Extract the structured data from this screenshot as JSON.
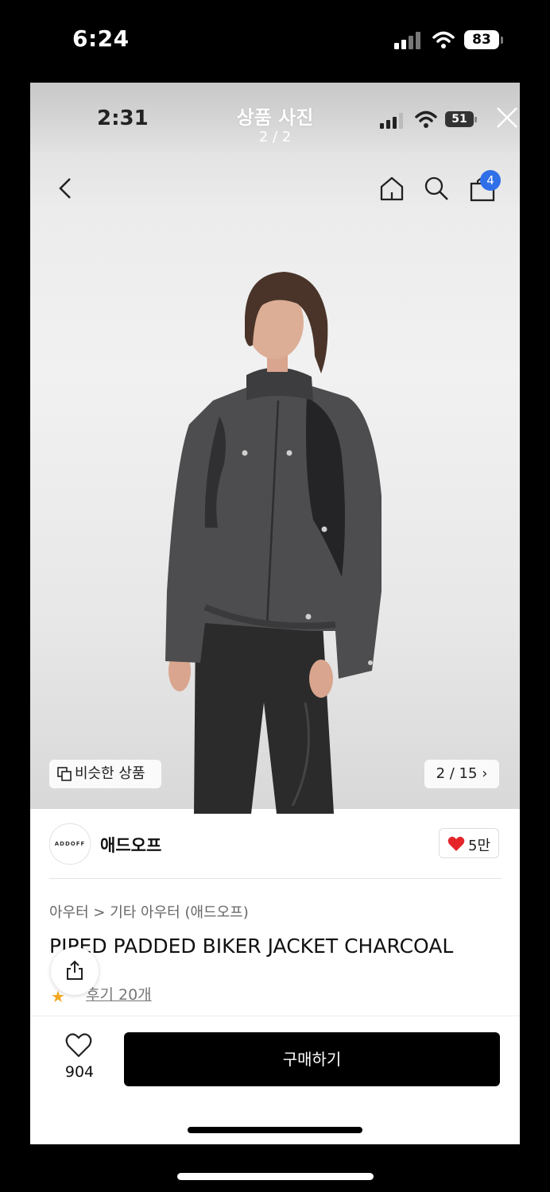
{
  "outer_status": {
    "time": "6:24",
    "battery": "83"
  },
  "inner_status": {
    "time": "2:31",
    "battery": "51"
  },
  "viewer": {
    "title": "상품 사진",
    "count": "2 / 2"
  },
  "header": {
    "cart_badge": "4"
  },
  "gallery": {
    "similar_label": "비슷한 상품",
    "page_indicator": "2 / 15"
  },
  "brand": {
    "logo_text": "ADDOFF",
    "name": "애드오프",
    "likes": "5만"
  },
  "product": {
    "breadcrumb": "아우터 > 기타 아우터 (애드오프)",
    "name": "PIPED PADDED BIKER JACKET CHARCOAL",
    "rating_star": "★",
    "review_link": "후기 20개"
  },
  "bottom": {
    "wish_count": "904",
    "buy_label": "구매하기"
  },
  "colors": {
    "accent_blue": "#2f6fe8",
    "like_red": "#e5252a",
    "buy_bg": "#000000",
    "star": "#f3a820"
  },
  "icons": [
    "signal-icon",
    "wifi-icon",
    "battery-icon",
    "close-icon",
    "back-chevron-icon",
    "home-icon",
    "search-icon",
    "cart-icon",
    "copy-icon",
    "heart-icon",
    "share-icon",
    "star-icon"
  ]
}
